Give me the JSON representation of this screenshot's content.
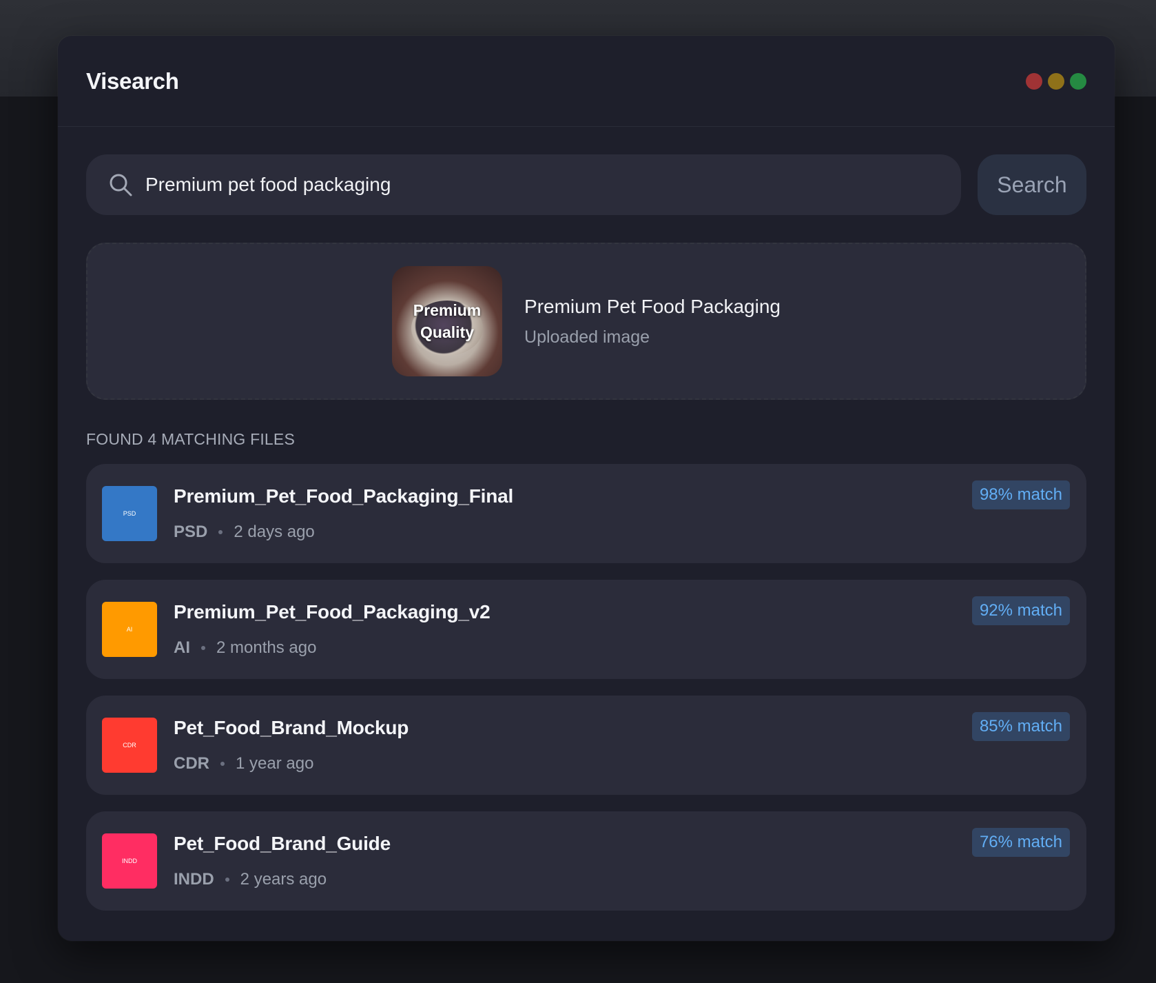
{
  "app": {
    "title": "Visearch"
  },
  "window_controls": {
    "close_color": "#a03335",
    "minimize_color": "#8f7119",
    "maximize_color": "#258a42"
  },
  "search": {
    "value": "Premium pet food packaging",
    "button_label": "Search",
    "icon": "search-icon"
  },
  "upload": {
    "thumbnail_text_line1": "Premium",
    "thumbnail_text_line2": "Quality",
    "title": "Premium Pet Food Packaging",
    "subtitle": "Uploaded image"
  },
  "results": {
    "header": "FOUND 4 MATCHING FILES",
    "items": [
      {
        "icon_label": "PSD",
        "icon_color": "#3478c6",
        "name": "Premium_Pet_Food_Packaging_Final",
        "type": "PSD",
        "date": "2 days ago",
        "match": "98% match"
      },
      {
        "icon_label": "AI",
        "icon_color": "#ff9a00",
        "name": "Premium_Pet_Food_Packaging_v2",
        "type": "AI",
        "date": "2 months ago",
        "match": "92% match"
      },
      {
        "icon_label": "CDR",
        "icon_color": "#ff3b30",
        "name": "Pet_Food_Brand_Mockup",
        "type": "CDR",
        "date": "1 year ago",
        "match": "85% match"
      },
      {
        "icon_label": "INDD",
        "icon_color": "#ff2d62",
        "name": "Pet_Food_Brand_Guide",
        "type": "INDD",
        "date": "2 years ago",
        "match": "76% match"
      }
    ]
  }
}
